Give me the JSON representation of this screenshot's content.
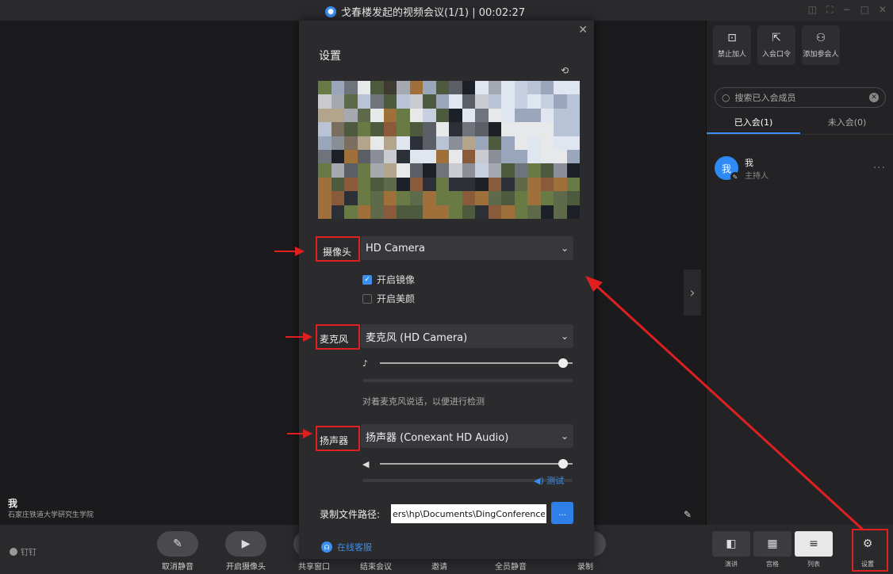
{
  "titlebar": {
    "title": "戈春楼发起的视频会议(1/1) | 00:02:27",
    "lock_icon": "shield-lock-icon",
    "window_controls": [
      "◫",
      "⛶",
      "−",
      "□",
      "✕"
    ]
  },
  "video": {
    "participant_name": "我",
    "participant_org": "石家庄铁道大学研究生学院"
  },
  "right_panel": {
    "buttons": [
      {
        "label": "禁止加人",
        "icon": "lock-open-icon",
        "glyph": "⊡"
      },
      {
        "label": "入会口令",
        "icon": "share-icon",
        "glyph": "⇱"
      },
      {
        "label": "添加参会人",
        "icon": "add-user-icon",
        "glyph": "⚇"
      }
    ],
    "search_placeholder": "搜索已入会成员",
    "tabs": [
      {
        "label": "已入会(1)",
        "active": true
      },
      {
        "label": "未入会(0)",
        "active": false
      }
    ],
    "member": {
      "avatar_text": "我",
      "name": "我",
      "role": "主持人"
    }
  },
  "settings": {
    "title": "设置",
    "camera_label": "摄像头",
    "camera_value": "HD Camera",
    "mirror_label": "开启镜像",
    "mirror_checked": true,
    "beauty_label": "开启美颜",
    "beauty_checked": false,
    "mic_label": "麦克风",
    "mic_value": "麦克风 (HD Camera)",
    "mic_volume": 0.95,
    "mic_hint": "对着麦克风说话，以便进行检测",
    "speaker_label": "扬声器",
    "speaker_value": "扬声器 (Conexant HD Audio)",
    "speaker_volume": 0.95,
    "test_label": "测试",
    "path_label": "录制文件路径:",
    "path_value": "ers\\hp\\Documents\\DingConference",
    "path_button": "...",
    "service_label": "在线客服"
  },
  "bottombar": {
    "logo": "钉钉",
    "controls": [
      {
        "label": "取消静音",
        "icon": "mic-off-icon",
        "glyph": "✎"
      },
      {
        "label": "开启摄像头",
        "icon": "camera-off-icon",
        "glyph": "▶"
      },
      {
        "label": "共享窗口",
        "icon": "share-screen-icon",
        "glyph": "▭"
      },
      {
        "label": "结束会议",
        "icon": "end-call-icon",
        "glyph": "✆"
      },
      {
        "label": "邀请",
        "icon": "invite-icon",
        "glyph": "+"
      },
      {
        "label": "全员静音",
        "icon": "mute-all-icon",
        "glyph": "✕"
      },
      {
        "label": "录制",
        "icon": "record-icon",
        "glyph": "●"
      }
    ],
    "layouts": [
      {
        "label": "演讲",
        "icon": "speaker-layout-icon",
        "glyph": "◧",
        "active": false
      },
      {
        "label": "宫格",
        "icon": "grid-layout-icon",
        "glyph": "▦",
        "active": false
      },
      {
        "label": "列表",
        "icon": "list-layout-icon",
        "glyph": "≡",
        "active": true
      }
    ],
    "settings_label": "设置"
  },
  "colors": {
    "accent": "#3a8ff0",
    "annotation": "#e02020",
    "background": "#1e1e20"
  }
}
